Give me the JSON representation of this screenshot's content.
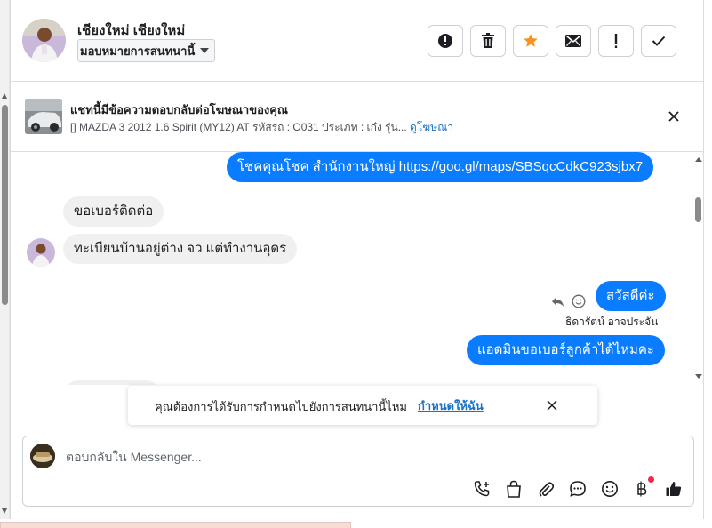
{
  "header": {
    "contact_name": "เชียงใหม่ เชียงใหม่",
    "assign_label": "มอบหมายการสนทนานี้",
    "actions": [
      {
        "name": "spam-button",
        "icon": "alert-circle-icon"
      },
      {
        "name": "delete-button",
        "icon": "trash-icon"
      },
      {
        "name": "star-button",
        "icon": "star-icon"
      },
      {
        "name": "mark-unread-button",
        "icon": "envelope-icon"
      },
      {
        "name": "follow-up-button",
        "icon": "exclamation-icon"
      },
      {
        "name": "mark-done-button",
        "icon": "check-icon"
      }
    ]
  },
  "ad": {
    "title": "แชทนี้มีข้อความตอบกลับต่อโฆษณาของคุณ",
    "subtitle": "[] MAZDA 3 2012 1.6 Spirit (MY12) AT รหัสรถ : O031 ประเภท : เก๋ง รุ่น...",
    "link_label": "ดูโฆษณา"
  },
  "messages": {
    "out_1_prefix": "โชคคุณโชค สำนักงานใหญ่",
    "out_1_link": "https://goo.gl/maps/SBSqcCdkC923sjbx7",
    "in_1": "ขอเบอร์ติดต่อ",
    "in_2": "ทะเบียนบ้านอยู่ต่าง จว แต่ทำงานอุดร",
    "out_2": "สวัสดีค่ะ",
    "out_2_sender": "ธิดารัตน์ อาจประจัน",
    "out_3": "แอดมินขอเบอร์ลูกค้าได้ไหมคะ"
  },
  "toast": {
    "text": "คุณต้องการได้รับการกำหนดไปยังการสนทนานี้ไหม",
    "link": "กำหนดให้ฉัน"
  },
  "composer": {
    "placeholder": "ตอบกลับใน Messenger...",
    "tools": [
      "phone-add-icon",
      "shopping-bag-icon",
      "paperclip-icon",
      "saved-reply-icon",
      "emoji-icon",
      "baht-icon",
      "thumbs-up-icon"
    ]
  },
  "colors": {
    "accent": "#0a7cff",
    "incoming_bubble": "#f0f0f0",
    "star": "#f7931e",
    "link": "#1a73c6",
    "notification_dot": "#f02849"
  }
}
